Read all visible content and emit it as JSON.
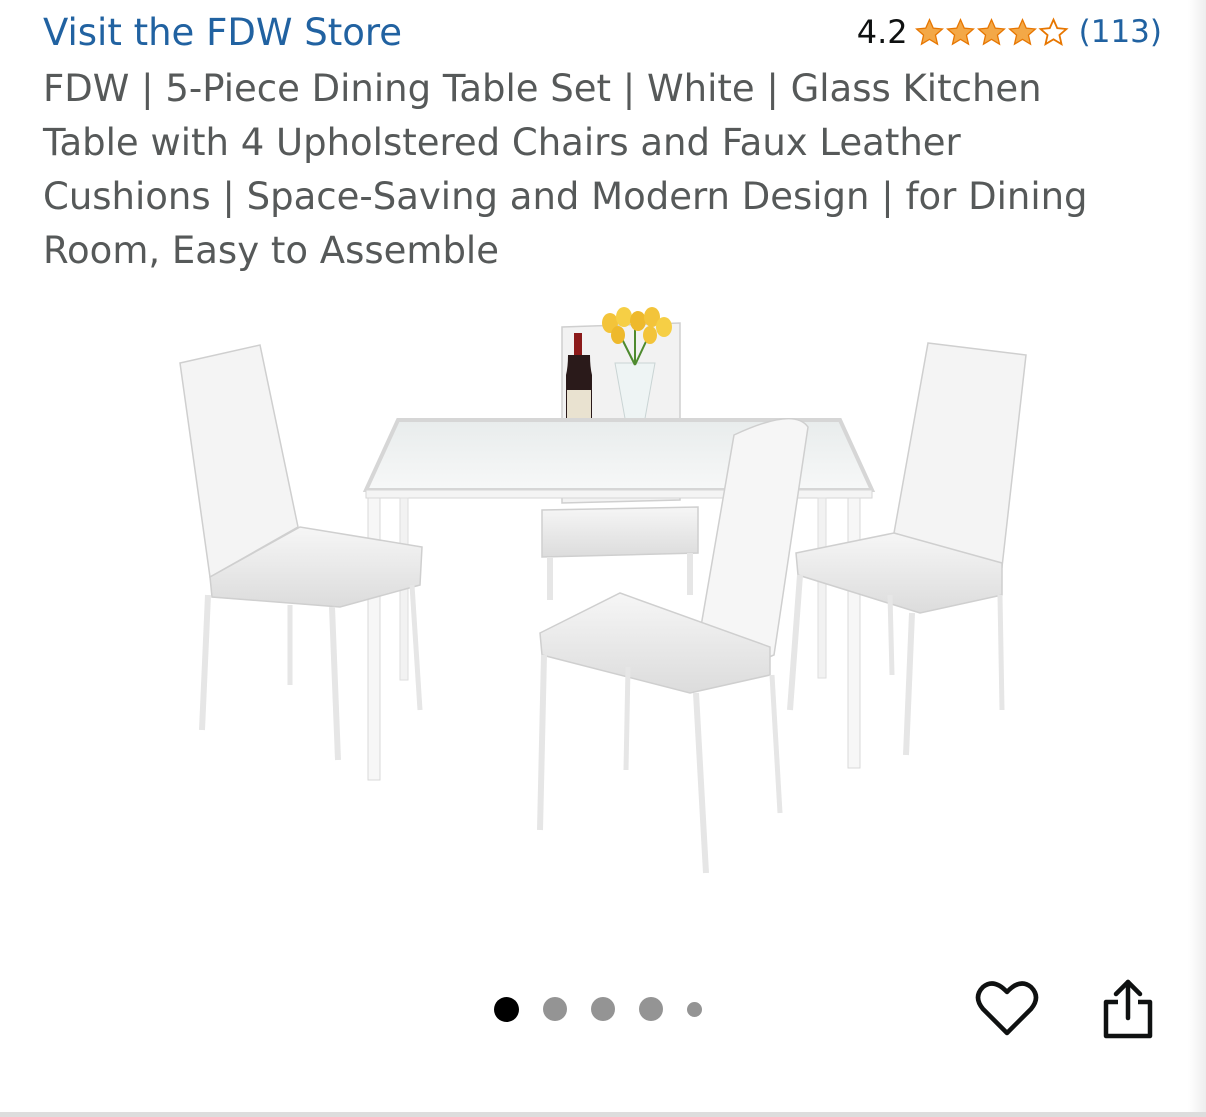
{
  "store_link": "Visit the FDW Store",
  "rating": {
    "value": "4.2",
    "count": "(113)",
    "stars_icon": "star-rating-icon",
    "star_color": "#f3a847",
    "stars_out_of_5": 4.2
  },
  "product_title": "FDW | 5-Piece Dining Table Set | White | Glass Kitchen Table with 4 Upholstered Chairs and Faux Leather Cushions | Space-Saving and Modern Design | for Dining Room, Easy to Assemble",
  "carousel": {
    "total_dots": 5,
    "active_index": 0
  },
  "actions": {
    "wishlist_icon": "heart-icon",
    "share_icon": "share-icon"
  },
  "colors": {
    "link": "#2162a1",
    "title": "#565959"
  }
}
